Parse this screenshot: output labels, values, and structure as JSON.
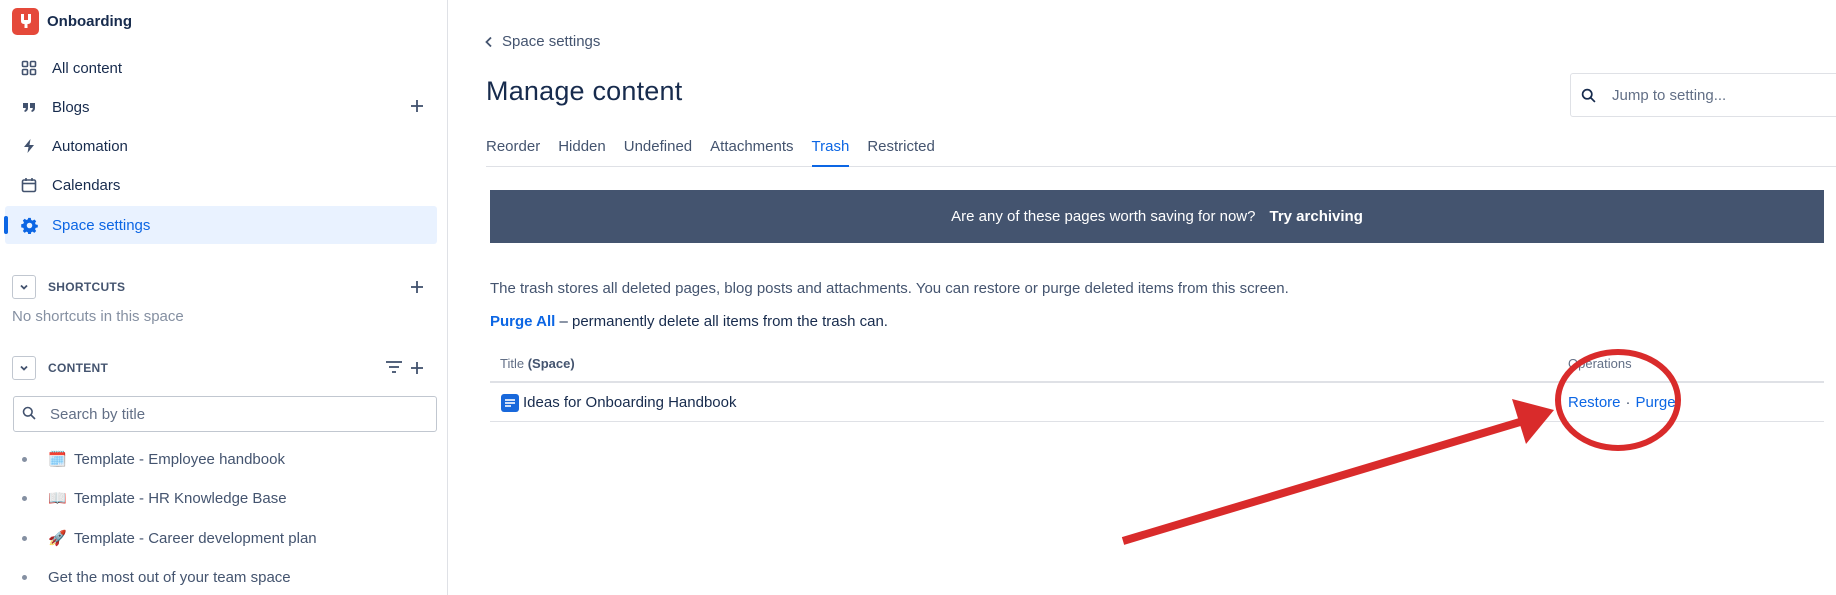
{
  "sidebar": {
    "space_name": "Onboarding",
    "nav": [
      {
        "label": "All content",
        "icon": "grid-icon"
      },
      {
        "label": "Blogs",
        "icon": "quote-icon"
      },
      {
        "label": "Automation",
        "icon": "lightning-icon"
      },
      {
        "label": "Calendars",
        "icon": "calendar-icon"
      },
      {
        "label": "Space settings",
        "icon": "gear-icon",
        "active": true
      }
    ],
    "shortcuts": {
      "title": "SHORTCUTS",
      "empty_text": "No shortcuts in this space"
    },
    "content": {
      "title": "CONTENT",
      "search_placeholder": "Search by title",
      "items": [
        {
          "emoji": "🗓️",
          "label": "Template - Employee handbook"
        },
        {
          "emoji": "📖",
          "label": "Template - HR Knowledge Base"
        },
        {
          "emoji": "🚀",
          "label": "Template - Career development plan"
        },
        {
          "emoji": "",
          "label": "Get the most out of your team space"
        }
      ]
    }
  },
  "main": {
    "back_label": "Space settings",
    "title": "Manage content",
    "jump_placeholder": "Jump to setting...",
    "tabs": [
      {
        "label": "Reorder"
      },
      {
        "label": "Hidden"
      },
      {
        "label": "Undefined"
      },
      {
        "label": "Attachments"
      },
      {
        "label": "Trash",
        "selected": true
      },
      {
        "label": "Restricted"
      }
    ],
    "banner": {
      "text": "Are any of these pages worth saving for now?",
      "link": "Try archiving"
    },
    "description": "The trash stores all deleted pages, blog posts and attachments. You can restore or purge deleted items from this screen.",
    "purge_all": {
      "link": "Purge All",
      "text": " – permanently delete all items from the trash can."
    },
    "table": {
      "col_title": "Title",
      "col_space": "(Space)",
      "col_ops": "Operations",
      "rows": [
        {
          "title": "Ideas for Onboarding Handbook",
          "restore": "Restore",
          "separator": "·",
          "purge": "Purge"
        }
      ]
    }
  },
  "colors": {
    "accent": "#0c66e4",
    "banner": "#44546f",
    "annotation": "#d92b2b",
    "logo": "#e5493a"
  }
}
